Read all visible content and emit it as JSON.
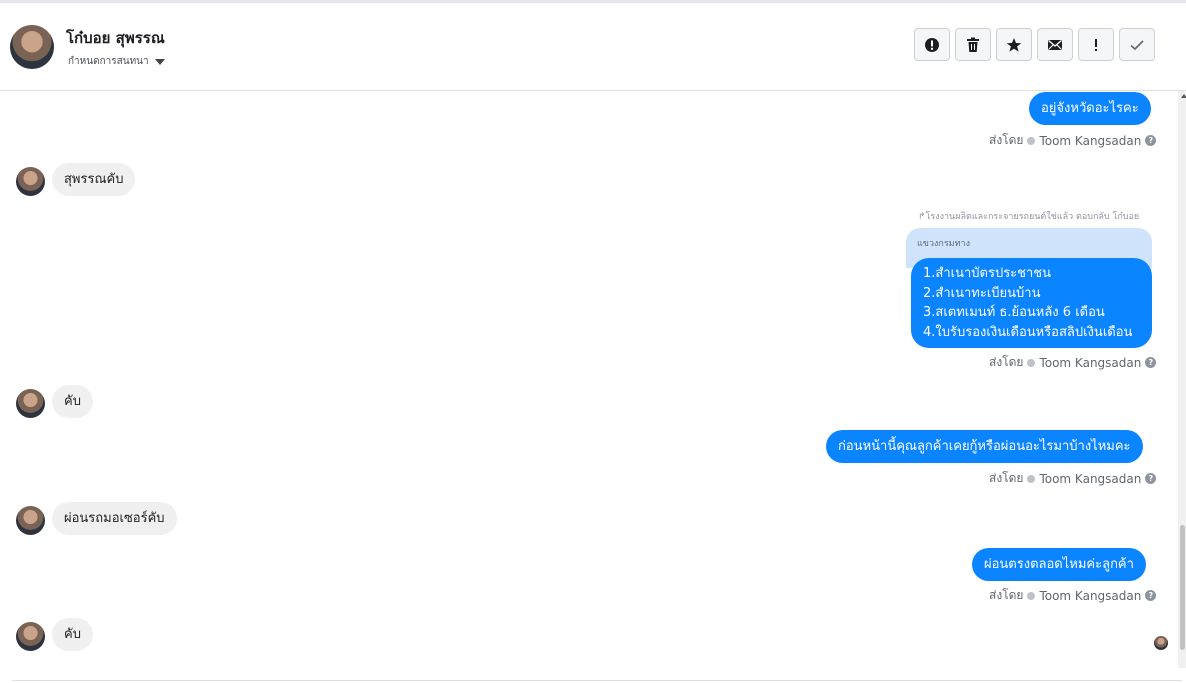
{
  "header": {
    "contact_name": "โก๋บอย สุพรรณ",
    "assign_label": "กำหนดการสนทนา",
    "actions": [
      {
        "name": "report-spam",
        "icon": "alert-circle-icon"
      },
      {
        "name": "delete",
        "icon": "trash-icon"
      },
      {
        "name": "star",
        "icon": "star-icon"
      },
      {
        "name": "mark-unread",
        "icon": "envelope-icon"
      },
      {
        "name": "important",
        "icon": "exclamation-icon"
      },
      {
        "name": "done",
        "icon": "check-icon"
      }
    ]
  },
  "messages": {
    "m1": {
      "text": "อยู่จังหวัดอะไรคะ"
    },
    "m2": {
      "text": "สุพรรณคับ"
    },
    "reply_note": "↱โรงงานผลิตและกระจายรถยนต์ใช่แล้ว ตอบกลับ โก๋บอย",
    "quoted_text": "แขวงกรมทาง",
    "list": [
      "1.สำเนาบัตรประชาชน",
      "2.สำเนาทะเบียนบ้าน",
      "3.สเตทเมนท์ ธ.ย้อนหลัง 6 เดือน",
      "4.ใบรับรองเงินเดือนหรือสลิปเงินเดือน"
    ],
    "m4": {
      "text": "คับ"
    },
    "m5": {
      "text": "ก่อนหน้านี้คุณลูกค้าเคยกู้หรือผ่อนอะไรมาบ้างไหมคะ"
    },
    "m6": {
      "text": "ผ่อนรถมอเซอร์คับ"
    },
    "m7": {
      "text": "ผ่อนตรงตลอดไหมค่ะลูกค้า"
    },
    "m8": {
      "text": "คับ"
    }
  },
  "sent_by": {
    "prefix": "ส่งโดย",
    "agent": "Toom Kangsadan",
    "help": "?"
  },
  "colors": {
    "outgoing_bubble": "#0b84ff",
    "incoming_bubble": "#f1f0f0",
    "quoted_bubble": "#cfe3fb"
  }
}
